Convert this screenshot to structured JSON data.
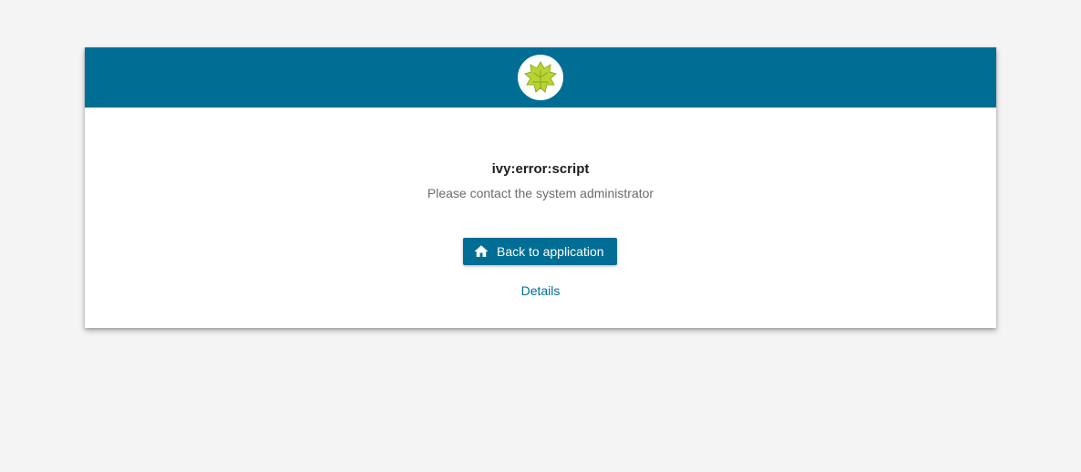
{
  "header": {
    "logo_icon": "ivy-leaf-icon",
    "brand_color": "#006e94",
    "logo_color": "#b7d433"
  },
  "error": {
    "title": "ivy:error:script",
    "message": "Please contact the system administrator"
  },
  "actions": {
    "back_label": "Back to application",
    "back_icon": "home-icon",
    "details_label": "Details"
  }
}
